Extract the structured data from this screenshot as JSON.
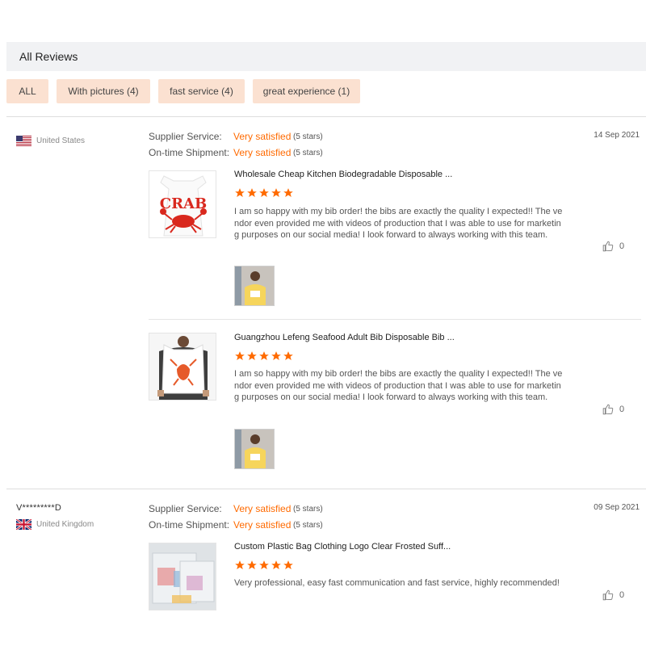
{
  "header": {
    "title": "All Reviews"
  },
  "filters": [
    {
      "label": "ALL"
    },
    {
      "label": "With pictures (4)"
    },
    {
      "label": "fast service (4)"
    },
    {
      "label": "great experience (1)"
    }
  ],
  "reviews": [
    {
      "user": "",
      "country": "United States",
      "date": "14 Sep 2021",
      "supplier_service": {
        "label": "Supplier Service:",
        "value": "Very satisfied",
        "stars": "(5 stars)"
      },
      "ontime_shipment": {
        "label": "On-time Shipment:",
        "value": "Very satisfied",
        "stars": "(5 stars)"
      },
      "items": [
        {
          "title": "Wholesale Cheap Kitchen Biodegradable Disposable ...",
          "rating": 5,
          "text": "I am so happy with my bib order! the bibs are exactly the quality I expected!! The vendor even provided me with videos of production that I was able to use for marketing purposes on our social media! I look forward to always working with this team.",
          "likes": "0",
          "thumb_text": "CRAB"
        },
        {
          "title": "Guangzhou Lefeng Seafood Adult Bib Disposable Bib ...",
          "rating": 5,
          "text": "I am so happy with my bib order! the bibs are exactly the quality I expected!! The vendor even provided me with videos of production that I was able to use for marketing purposes on our social media! I look forward to always working with this team.",
          "likes": "0"
        }
      ]
    },
    {
      "user": "V*********D",
      "country": "United Kingdom",
      "date": "09 Sep 2021",
      "supplier_service": {
        "label": "Supplier Service:",
        "value": "Very satisfied",
        "stars": "(5 stars)"
      },
      "ontime_shipment": {
        "label": "On-time Shipment:",
        "value": "Very satisfied",
        "stars": "(5 stars)"
      },
      "items": [
        {
          "title": "Custom Plastic Bag Clothing Logo Clear Frosted Suff...",
          "rating": 5,
          "text": "Very professional, easy fast communication and fast service, highly recommended!",
          "likes": "0"
        }
      ]
    }
  ],
  "colors": {
    "accent": "#ff6a00",
    "filter_bg": "#fbe1d1",
    "header_bg": "#f1f2f4"
  },
  "icons": {
    "star": "star-icon",
    "like": "thumbs-up-icon",
    "us_flag": "us-flag-icon",
    "uk_flag": "uk-flag-icon"
  }
}
